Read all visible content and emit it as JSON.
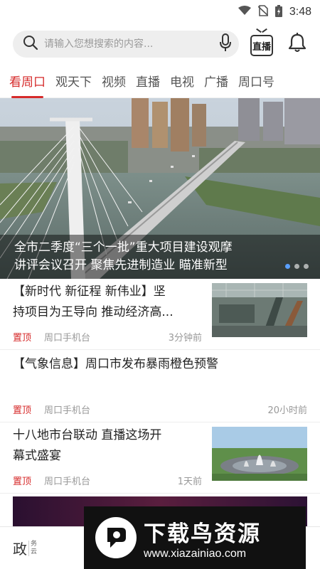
{
  "status_bar": {
    "time": "3:48"
  },
  "search": {
    "placeholder": "请输入您想搜索的内容..."
  },
  "header": {
    "live_label": "直播"
  },
  "tabs": [
    {
      "label": "看周口",
      "active": true
    },
    {
      "label": "观天下",
      "active": false
    },
    {
      "label": "视频",
      "active": false
    },
    {
      "label": "直播",
      "active": false
    },
    {
      "label": "电视",
      "active": false
    },
    {
      "label": "广播",
      "active": false
    },
    {
      "label": "周口号",
      "active": false
    }
  ],
  "banner": {
    "caption_line1": "全市二季度“三个一批”重大项目建设观摩",
    "caption_line2": "讲评会议召开 聚焦先进制造业 瞄准新型",
    "slides": 3,
    "active_slide": 0
  },
  "news": [
    {
      "title_line1": "【新时代 新征程 新伟业】坚",
      "title_line2": "持项目为王导向 推动经济高...",
      "tag": "置顶",
      "source": "周口手机台",
      "time": "3分钟前",
      "thumb": "factory-photo"
    },
    {
      "title_line1": "【气象信息】周口市发布暴雨橙色预警",
      "title_line2": "",
      "tag": "置顶",
      "source": "周口手机台",
      "time": "20小时前",
      "thumb": ""
    },
    {
      "title_line1": "十八地市台联动  直播这场开",
      "title_line2": "幕式盛宴",
      "tag": "置顶",
      "source": "周口手机台",
      "time": "1天前",
      "thumb": "fountain-photo"
    }
  ],
  "bottom_nav": [
    {
      "big": "政",
      "small_top": "务",
      "small_bottom": "云"
    }
  ],
  "watermark": {
    "cn": "下载鸟资源",
    "url": "www.xiazainiao.com"
  },
  "colors": {
    "accent": "#d62b2b",
    "active_dot": "#5aa0ff"
  }
}
